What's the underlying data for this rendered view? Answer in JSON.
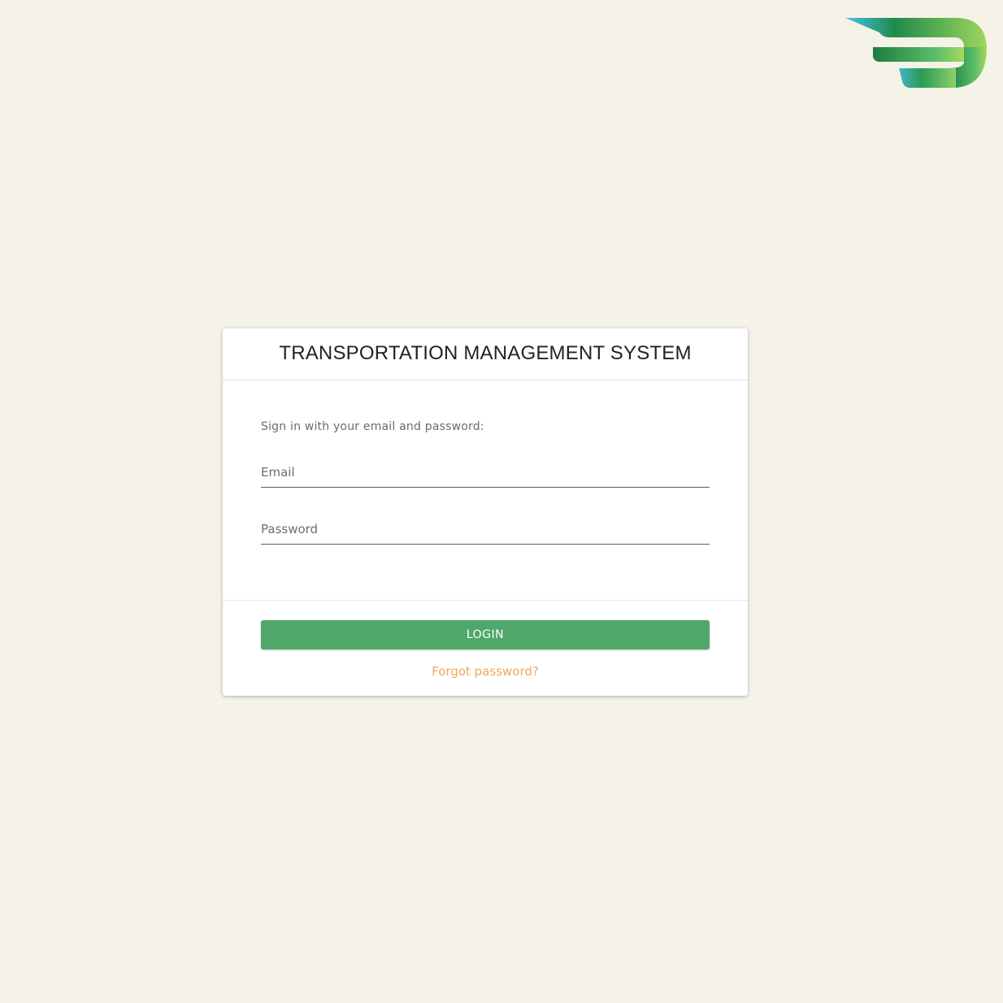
{
  "logo": {
    "name": "brand-logo",
    "colors": [
      "#4ab8e8",
      "#1e8b4a",
      "#7cc86a",
      "#a6d85b"
    ]
  },
  "card": {
    "title": "TRANSPORTATION MANAGEMENT SYSTEM",
    "subtitle": "Sign in with your email and password:",
    "email": {
      "placeholder": "Email",
      "value": ""
    },
    "password": {
      "placeholder": "Password",
      "value": ""
    },
    "login_label": "LOGIN",
    "forgot_label": "Forgot password?"
  },
  "colors": {
    "background": "#f5f3e8",
    "accent": "#4fa86a",
    "link": "#efa85e"
  }
}
